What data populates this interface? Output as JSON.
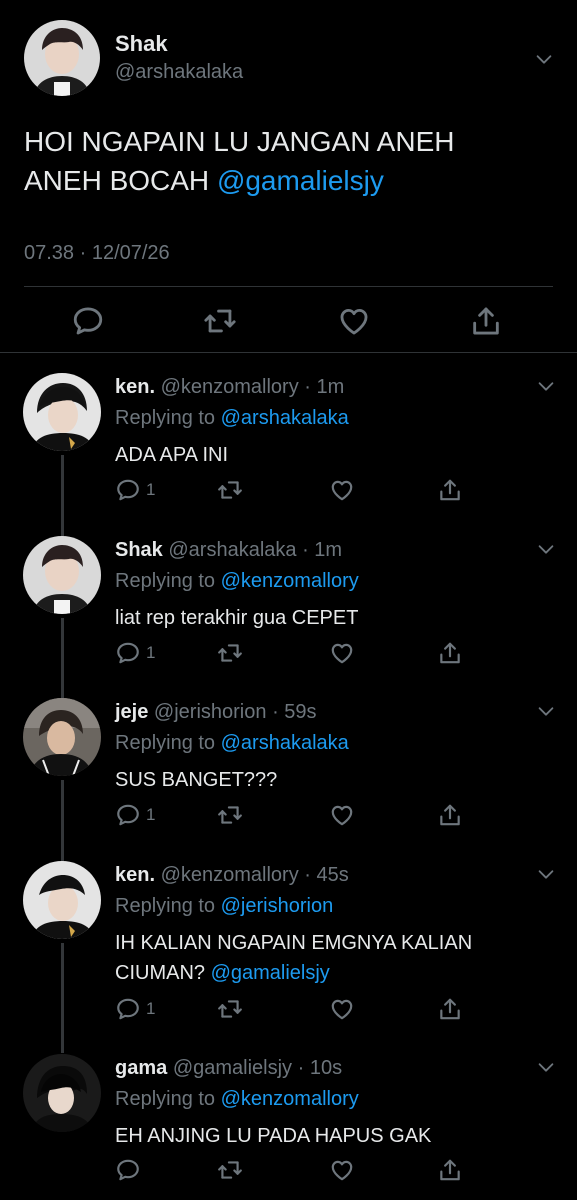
{
  "main_tweet": {
    "name": "Shak",
    "handle": "@arshakalaka",
    "text_line1": "HOI NGAPAIN LU JANGAN ANEH",
    "text_line2_prefix": "ANEH BOCAH ",
    "mention": "@gamalielsjy",
    "timestamp": "07.38 · 12/07/26"
  },
  "replies": [
    {
      "name": "ken.",
      "handle": "@kenzomallory",
      "time": "· 1m",
      "replying_label": "Replying to ",
      "replying_to": "@arshakalaka",
      "text": "ADA APA INI",
      "text_mention": "",
      "reply_count": "1"
    },
    {
      "name": "Shak",
      "handle": "@arshakalaka",
      "time": "· 1m",
      "replying_label": "Replying to ",
      "replying_to": "@kenzomallory",
      "text": "liat rep terakhir gua CEPET",
      "text_mention": "",
      "reply_count": "1"
    },
    {
      "name": "jeje",
      "handle": "@jerishorion",
      "time": "· 59s",
      "replying_label": "Replying to ",
      "replying_to": "@arshakalaka",
      "text": "SUS BANGET???",
      "text_mention": "",
      "reply_count": "1"
    },
    {
      "name": "ken.",
      "handle": "@kenzomallory",
      "time": "· 45s",
      "replying_label": "Replying to ",
      "replying_to": "@jerishorion",
      "text": "IH KALIAN NGAPAIN EMGNYA KALIAN CIUMAN? ",
      "text_mention": "@gamalielsjy",
      "reply_count": "1"
    },
    {
      "name": "gama",
      "handle": "@gamalielsjy",
      "time": "· 10s",
      "replying_label": "Replying to ",
      "replying_to": "@kenzomallory",
      "text": "EH ANJING LU PADA HAPUS GAK",
      "text_mention": "",
      "reply_count": ""
    }
  ],
  "icons": [
    "reply-icon",
    "retweet-icon",
    "like-icon",
    "share-icon",
    "chevron-down-icon"
  ],
  "colors": {
    "background": "#000000",
    "text": "#e7e9ea",
    "muted": "#6e767d",
    "link": "#1d9bf0"
  }
}
